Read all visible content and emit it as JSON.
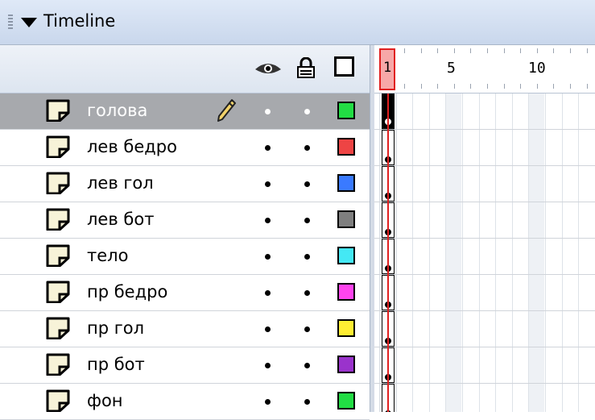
{
  "panel": {
    "title": "Timeline"
  },
  "header": {
    "eye_icon": "eye-icon",
    "lock_icon": "lock-icon",
    "outline_icon": "outline-icon"
  },
  "frames": {
    "labels": [
      "1",
      "5",
      "10"
    ]
  },
  "layers": [
    {
      "name": "голова",
      "color": "#22dd44",
      "selected": true,
      "editing": true
    },
    {
      "name": "лев бедро",
      "color": "#ee4444",
      "selected": false
    },
    {
      "name": "лев гол",
      "color": "#3a7aff",
      "selected": false
    },
    {
      "name": "лев бот",
      "color": "#7f7f7f",
      "selected": false
    },
    {
      "name": "тело",
      "color": "#44e8f4",
      "selected": false
    },
    {
      "name": "пр бедро",
      "color": "#ff44ee",
      "selected": false
    },
    {
      "name": "пр гол",
      "color": "#ffee33",
      "selected": false
    },
    {
      "name": "пр бот",
      "color": "#9a33cc",
      "selected": false
    },
    {
      "name": "фон",
      "color": "#22dd44",
      "selected": false
    }
  ]
}
